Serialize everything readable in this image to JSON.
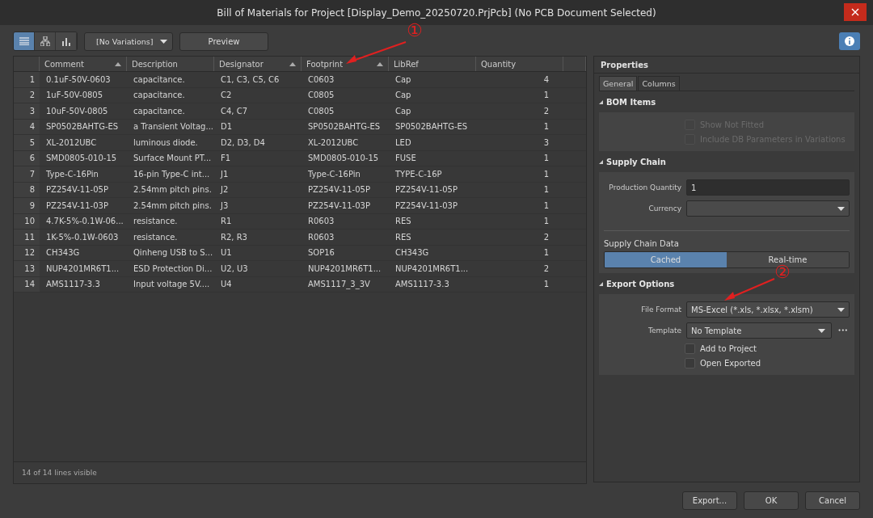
{
  "window": {
    "title": "Bill of Materials for Project [Display_Demo_20250720.PrjPcb] (No PCB Document Selected)"
  },
  "toolbar": {
    "views": [
      {
        "kind": "list",
        "selected": true
      },
      {
        "kind": "tree",
        "selected": false
      },
      {
        "kind": "chart",
        "selected": false
      }
    ],
    "variations": "[No Variations]",
    "preview": "Preview"
  },
  "table": {
    "columns": [
      {
        "label": "Comment",
        "sorted": true
      },
      {
        "label": "Description",
        "sorted": false
      },
      {
        "label": "Designator",
        "sorted": true
      },
      {
        "label": "Footprint",
        "sorted": true
      },
      {
        "label": "LibRef",
        "sorted": false
      },
      {
        "label": "Quantity",
        "sorted": false
      }
    ],
    "rows": [
      {
        "number": "1",
        "cells": [
          "0.1uF-50V-0603",
          "capacitance.",
          "C1, C3, C5, C6",
          "C0603",
          "Cap",
          "4"
        ]
      },
      {
        "number": "2",
        "cells": [
          "1uF-50V-0805",
          "capacitance.",
          "C2",
          "C0805",
          "Cap",
          "1"
        ]
      },
      {
        "number": "3",
        "cells": [
          "10uF-50V-0805",
          "capacitance.",
          "C4, C7",
          "C0805",
          "Cap",
          "2"
        ]
      },
      {
        "number": "4",
        "cells": [
          "SP0502BAHTG-ES",
          "a Transient Voltag...",
          "D1",
          "SP0502BAHTG-ES",
          "SP0502BAHTG-ES",
          "1"
        ]
      },
      {
        "number": "5",
        "cells": [
          "XL-2012UBC",
          "luminous diode.",
          "D2, D3, D4",
          "XL-2012UBC",
          "LED",
          "3"
        ]
      },
      {
        "number": "6",
        "cells": [
          "SMD0805-010-15",
          "Surface Mount PT...",
          "F1",
          "SMD0805-010-15",
          "FUSE",
          "1"
        ]
      },
      {
        "number": "7",
        "cells": [
          "Type-C-16Pin",
          "16-pin Type-C int...",
          "J1",
          "Type-C-16Pin",
          "TYPE-C-16P",
          "1"
        ]
      },
      {
        "number": "8",
        "cells": [
          "PZ254V-11-05P",
          "2.54mm pitch pins.",
          "J2",
          "PZ254V-11-05P",
          "PZ254V-11-05P",
          "1"
        ]
      },
      {
        "number": "9",
        "cells": [
          "PZ254V-11-03P",
          "2.54mm pitch pins.",
          "J3",
          "PZ254V-11-03P",
          "PZ254V-11-03P",
          "1"
        ]
      },
      {
        "number": "10",
        "cells": [
          "4.7K-5%-0.1W-06...",
          "resistance.",
          "R1",
          "R0603",
          "RES",
          "1"
        ]
      },
      {
        "number": "11",
        "cells": [
          "1K-5%-0.1W-0603",
          "resistance.",
          "R2, R3",
          "R0603",
          "RES",
          "2"
        ]
      },
      {
        "number": "12",
        "cells": [
          "CH343G",
          "Qinheng USB to S...",
          "U1",
          "SOP16",
          "CH343G",
          "1"
        ]
      },
      {
        "number": "13",
        "cells": [
          "NUP4201MR6T1...",
          "ESD Protection Di...",
          "U2, U3",
          "NUP4201MR6T1...",
          "NUP4201MR6T1...",
          "2"
        ]
      },
      {
        "number": "14",
        "cells": [
          "AMS1117-3.3",
          "Input voltage 5V....",
          "U4",
          "AMS1117_3_3V",
          "AMS1117-3.3",
          "1"
        ]
      }
    ],
    "status": "14 of 14 lines visible"
  },
  "properties": {
    "title": "Properties",
    "tabs": [
      {
        "label": "General",
        "selected": true
      },
      {
        "label": "Columns",
        "selected": false
      }
    ],
    "bom_items": {
      "title": "BOM Items",
      "checkboxes": [
        {
          "label": "Show Not Fitted",
          "checked": false,
          "disabled": true
        },
        {
          "label": "Include DB Parameters in Variations",
          "checked": false,
          "disabled": true
        }
      ]
    },
    "supply_chain": {
      "title": "Supply Chain",
      "production_quantity_label": "Production Quantity",
      "production_quantity": "1",
      "currency_label": "Currency",
      "data_label": "Supply Chain Data",
      "modes": [
        {
          "label": "Cached",
          "selected": true
        },
        {
          "label": "Real-time",
          "selected": false
        }
      ]
    },
    "export_options": {
      "title": "Export Options",
      "file_format_label": "File Format",
      "file_format": "MS-Excel (*.xls, *.xlsx, *.xlsm)",
      "template_label": "Template",
      "template": "No Template",
      "template_more": "•••",
      "checkboxes": [
        {
          "label": "Add to Project",
          "checked": false,
          "disabled": false
        },
        {
          "label": "Open Exported",
          "checked": false,
          "disabled": false
        }
      ]
    }
  },
  "buttons": [
    "Export...",
    "OK",
    "Cancel"
  ],
  "annotations": [
    {
      "label": "①"
    },
    {
      "label": "②"
    }
  ]
}
